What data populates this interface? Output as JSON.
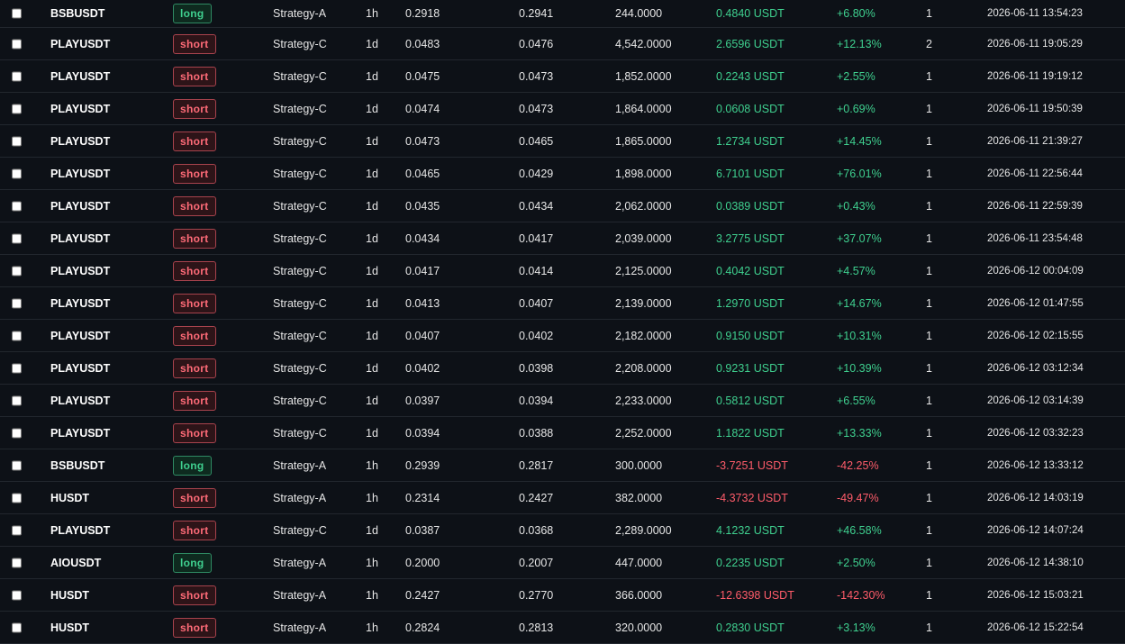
{
  "colors": {
    "background": "#0d1117",
    "positive": "#3fd08f",
    "negative": "#ff5c6a",
    "short_badge": "#ff6b78",
    "long_badge": "#3fd08f"
  },
  "rows": [
    {
      "symbol": "BSBUSDT",
      "side": "long",
      "strategy": "Strategy-A",
      "tf": "1h",
      "entry": "0.2918",
      "exit": "0.2941",
      "qty": "244.0000",
      "pnl": "0.4840 USDT",
      "pct": "+6.80%",
      "count": "1",
      "time": "2026-06-11 13:54:23",
      "profit": true
    },
    {
      "symbol": "PLAYUSDT",
      "side": "short",
      "strategy": "Strategy-C",
      "tf": "1d",
      "entry": "0.0483",
      "exit": "0.0476",
      "qty": "4,542.0000",
      "pnl": "2.6596 USDT",
      "pct": "+12.13%",
      "count": "2",
      "time": "2026-06-11 19:05:29",
      "profit": true
    },
    {
      "symbol": "PLAYUSDT",
      "side": "short",
      "strategy": "Strategy-C",
      "tf": "1d",
      "entry": "0.0475",
      "exit": "0.0473",
      "qty": "1,852.0000",
      "pnl": "0.2243 USDT",
      "pct": "+2.55%",
      "count": "1",
      "time": "2026-06-11 19:19:12",
      "profit": true
    },
    {
      "symbol": "PLAYUSDT",
      "side": "short",
      "strategy": "Strategy-C",
      "tf": "1d",
      "entry": "0.0474",
      "exit": "0.0473",
      "qty": "1,864.0000",
      "pnl": "0.0608 USDT",
      "pct": "+0.69%",
      "count": "1",
      "time": "2026-06-11 19:50:39",
      "profit": true
    },
    {
      "symbol": "PLAYUSDT",
      "side": "short",
      "strategy": "Strategy-C",
      "tf": "1d",
      "entry": "0.0473",
      "exit": "0.0465",
      "qty": "1,865.0000",
      "pnl": "1.2734 USDT",
      "pct": "+14.45%",
      "count": "1",
      "time": "2026-06-11 21:39:27",
      "profit": true
    },
    {
      "symbol": "PLAYUSDT",
      "side": "short",
      "strategy": "Strategy-C",
      "tf": "1d",
      "entry": "0.0465",
      "exit": "0.0429",
      "qty": "1,898.0000",
      "pnl": "6.7101 USDT",
      "pct": "+76.01%",
      "count": "1",
      "time": "2026-06-11 22:56:44",
      "profit": true
    },
    {
      "symbol": "PLAYUSDT",
      "side": "short",
      "strategy": "Strategy-C",
      "tf": "1d",
      "entry": "0.0435",
      "exit": "0.0434",
      "qty": "2,062.0000",
      "pnl": "0.0389 USDT",
      "pct": "+0.43%",
      "count": "1",
      "time": "2026-06-11 22:59:39",
      "profit": true
    },
    {
      "symbol": "PLAYUSDT",
      "side": "short",
      "strategy": "Strategy-C",
      "tf": "1d",
      "entry": "0.0434",
      "exit": "0.0417",
      "qty": "2,039.0000",
      "pnl": "3.2775 USDT",
      "pct": "+37.07%",
      "count": "1",
      "time": "2026-06-11 23:54:48",
      "profit": true
    },
    {
      "symbol": "PLAYUSDT",
      "side": "short",
      "strategy": "Strategy-C",
      "tf": "1d",
      "entry": "0.0417",
      "exit": "0.0414",
      "qty": "2,125.0000",
      "pnl": "0.4042 USDT",
      "pct": "+4.57%",
      "count": "1",
      "time": "2026-06-12 00:04:09",
      "profit": true
    },
    {
      "symbol": "PLAYUSDT",
      "side": "short",
      "strategy": "Strategy-C",
      "tf": "1d",
      "entry": "0.0413",
      "exit": "0.0407",
      "qty": "2,139.0000",
      "pnl": "1.2970 USDT",
      "pct": "+14.67%",
      "count": "1",
      "time": "2026-06-12 01:47:55",
      "profit": true
    },
    {
      "symbol": "PLAYUSDT",
      "side": "short",
      "strategy": "Strategy-C",
      "tf": "1d",
      "entry": "0.0407",
      "exit": "0.0402",
      "qty": "2,182.0000",
      "pnl": "0.9150 USDT",
      "pct": "+10.31%",
      "count": "1",
      "time": "2026-06-12 02:15:55",
      "profit": true
    },
    {
      "symbol": "PLAYUSDT",
      "side": "short",
      "strategy": "Strategy-C",
      "tf": "1d",
      "entry": "0.0402",
      "exit": "0.0398",
      "qty": "2,208.0000",
      "pnl": "0.9231 USDT",
      "pct": "+10.39%",
      "count": "1",
      "time": "2026-06-12 03:12:34",
      "profit": true
    },
    {
      "symbol": "PLAYUSDT",
      "side": "short",
      "strategy": "Strategy-C",
      "tf": "1d",
      "entry": "0.0397",
      "exit": "0.0394",
      "qty": "2,233.0000",
      "pnl": "0.5812 USDT",
      "pct": "+6.55%",
      "count": "1",
      "time": "2026-06-12 03:14:39",
      "profit": true
    },
    {
      "symbol": "PLAYUSDT",
      "side": "short",
      "strategy": "Strategy-C",
      "tf": "1d",
      "entry": "0.0394",
      "exit": "0.0388",
      "qty": "2,252.0000",
      "pnl": "1.1822 USDT",
      "pct": "+13.33%",
      "count": "1",
      "time": "2026-06-12 03:32:23",
      "profit": true
    },
    {
      "symbol": "BSBUSDT",
      "side": "long",
      "strategy": "Strategy-A",
      "tf": "1h",
      "entry": "0.2939",
      "exit": "0.2817",
      "qty": "300.0000",
      "pnl": "-3.7251 USDT",
      "pct": "-42.25%",
      "count": "1",
      "time": "2026-06-12 13:33:12",
      "profit": false
    },
    {
      "symbol": "HUSDT",
      "side": "short",
      "strategy": "Strategy-A",
      "tf": "1h",
      "entry": "0.2314",
      "exit": "0.2427",
      "qty": "382.0000",
      "pnl": "-4.3732 USDT",
      "pct": "-49.47%",
      "count": "1",
      "time": "2026-06-12 14:03:19",
      "profit": false
    },
    {
      "symbol": "PLAYUSDT",
      "side": "short",
      "strategy": "Strategy-C",
      "tf": "1d",
      "entry": "0.0387",
      "exit": "0.0368",
      "qty": "2,289.0000",
      "pnl": "4.1232 USDT",
      "pct": "+46.58%",
      "count": "1",
      "time": "2026-06-12 14:07:24",
      "profit": true
    },
    {
      "symbol": "AIOUSDT",
      "side": "long",
      "strategy": "Strategy-A",
      "tf": "1h",
      "entry": "0.2000",
      "exit": "0.2007",
      "qty": "447.0000",
      "pnl": "0.2235 USDT",
      "pct": "+2.50%",
      "count": "1",
      "time": "2026-06-12 14:38:10",
      "profit": true
    },
    {
      "symbol": "HUSDT",
      "side": "short",
      "strategy": "Strategy-A",
      "tf": "1h",
      "entry": "0.2427",
      "exit": "0.2770",
      "qty": "366.0000",
      "pnl": "-12.6398 USDT",
      "pct": "-142.30%",
      "count": "1",
      "time": "2026-06-12 15:03:21",
      "profit": false
    },
    {
      "symbol": "HUSDT",
      "side": "short",
      "strategy": "Strategy-A",
      "tf": "1h",
      "entry": "0.2824",
      "exit": "0.2813",
      "qty": "320.0000",
      "pnl": "0.2830 USDT",
      "pct": "+3.13%",
      "count": "1",
      "time": "2026-06-12 15:22:54",
      "profit": true
    }
  ]
}
